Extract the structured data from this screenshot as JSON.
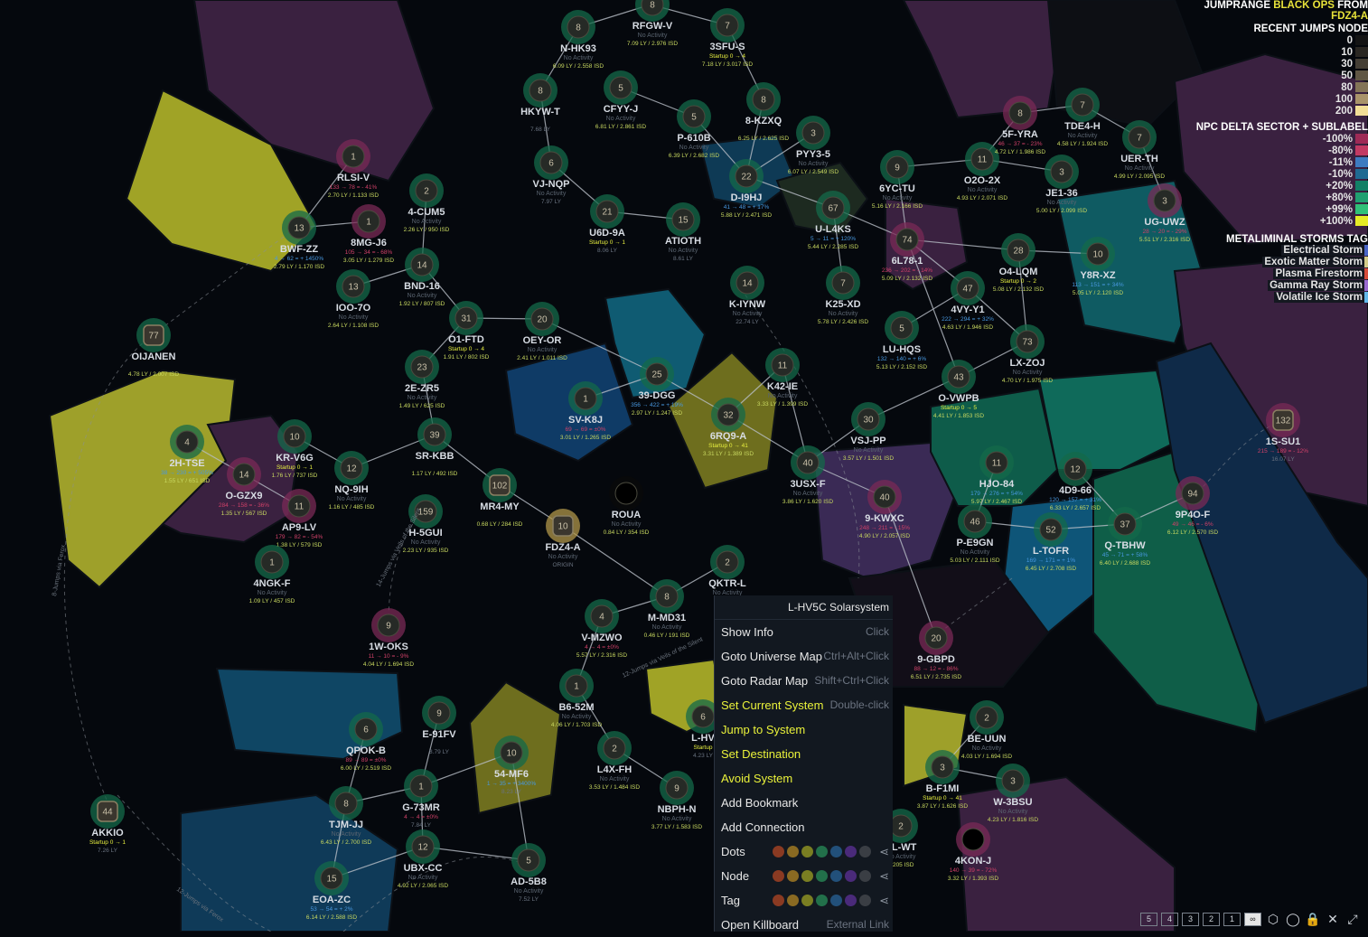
{
  "header": {
    "jumprange_prefix": "JUMPRANGE",
    "ship": "BLACK OPS",
    "from_label": "FROM",
    "origin": "FDZ4-A"
  },
  "legends": {
    "recent_jumps": {
      "title": "RECENT JUMPS NODE",
      "items": [
        {
          "label": "0",
          "color": "#141414"
        },
        {
          "label": "10",
          "color": "#2a2722"
        },
        {
          "label": "30",
          "color": "#443e34"
        },
        {
          "label": "50",
          "color": "#605744"
        },
        {
          "label": "80",
          "color": "#837457"
        },
        {
          "label": "100",
          "color": "#a9936a"
        },
        {
          "label": "200",
          "color": "#f2de96"
        }
      ]
    },
    "npc_delta": {
      "title": "NPC DELTA SECTOR + SUBLABEL",
      "items": [
        {
          "label": "-100%",
          "color": "#9e2a56"
        },
        {
          "label": "-80%",
          "color": "#c23a63"
        },
        {
          "label": "-11%",
          "color": "#3d7bc0"
        },
        {
          "label": "-10%",
          "color": "#1f6a92"
        },
        {
          "label": "+20%",
          "color": "#128066"
        },
        {
          "label": "+80%",
          "color": "#20a070"
        },
        {
          "label": "+99%",
          "color": "#30c078"
        },
        {
          "label": "+100%",
          "color": "#e6ec26"
        }
      ]
    },
    "storms": {
      "title": "METALIMINAL STORMS TAG",
      "items": [
        {
          "label": "Electrical Storm",
          "color": "#4a66c6"
        },
        {
          "label": "Exotic Matter Storm",
          "color": "#d4cc88"
        },
        {
          "label": "Plasma Firestorm",
          "color": "#d84c3a"
        },
        {
          "label": "Gamma Ray Storm",
          "color": "#9a6ad0"
        },
        {
          "label": "Volatile Ice Storm",
          "color": "#62b8ea"
        }
      ]
    }
  },
  "context_menu": {
    "title": "L-HV5C Solarsystem",
    "items": [
      {
        "label": "Show Info",
        "hint": "Click",
        "highlight": false
      },
      {
        "label": "Goto Universe Map",
        "hint": "Ctrl+Alt+Click",
        "highlight": false
      },
      {
        "label": "Goto Radar Map",
        "hint": "Shift+Ctrl+Click",
        "highlight": false
      },
      {
        "label": "Set Current System",
        "hint": "Double-click",
        "highlight": true
      },
      {
        "label": "Jump to System",
        "hint": "",
        "highlight": true
      },
      {
        "label": "Set Destination",
        "hint": "",
        "highlight": true
      },
      {
        "label": "Avoid System",
        "hint": "",
        "highlight": true
      },
      {
        "label": "Add Bookmark",
        "hint": "",
        "highlight": false
      },
      {
        "label": "Add Connection",
        "hint": "",
        "highlight": false
      }
    ],
    "color_rows": [
      {
        "label": "Dots"
      },
      {
        "label": "Node"
      },
      {
        "label": "Tag"
      }
    ],
    "palette": [
      "#8a3a22",
      "#8a6a22",
      "#7a7e22",
      "#22704a",
      "#22507a",
      "#4a2a7a",
      "#3a3e44"
    ],
    "last_item": {
      "label": "Open Killboard",
      "hint": "External Link"
    }
  },
  "zoom_buttons": [
    "5",
    "4",
    "3",
    "2",
    "1",
    "∞"
  ],
  "systems": [
    {
      "name": "RFGW-V",
      "count": "8",
      "sub": "No Activity",
      "info": "7.09 LY / 2.976 ISD"
    },
    {
      "name": "N-HK93",
      "count": "8",
      "sub": "No Activity",
      "info": "6.09 LY / 2.558 ISD"
    },
    {
      "name": "3SFU-S",
      "count": "7",
      "sub": "Startup 0 → 4",
      "info": "7.18 LY / 3.017 ISD"
    },
    {
      "name": "HKYW-T",
      "count": "8",
      "sub": "",
      "info": "7.68 LY"
    },
    {
      "name": "CFYY-J",
      "count": "5",
      "sub": "No Activity",
      "info": "6.81 LY / 2.861 ISD"
    },
    {
      "name": "P-610B",
      "count": "5",
      "sub": "No Activity",
      "info": "6.39 LY / 2.682 ISD"
    },
    {
      "name": "8-KZXQ",
      "count": "8",
      "sub": "",
      "info": "6.25 LY / 2.625 ISD"
    },
    {
      "name": "PYY3-5",
      "count": "3",
      "sub": "No Activity",
      "info": "6.07 LY / 2.549 ISD"
    },
    {
      "name": "D-I9HJ",
      "count": "22",
      "sub": "41 → 48 = + 17%",
      "info": "5.88 LY / 2.471 ISD"
    },
    {
      "name": "VJ-NQP",
      "count": "6",
      "sub": "No Activity",
      "info": "7.97 LY"
    },
    {
      "name": "U6D-9A",
      "count": "21",
      "sub": "Startup 0 → 1",
      "info": "8.06 LY"
    },
    {
      "name": "ATIOTH",
      "count": "15",
      "sub": "No Activity",
      "info": "8.61 LY"
    },
    {
      "name": "U-L4KS",
      "count": "67",
      "sub": "5 → 11 = + 120%",
      "info": "5.44 LY / 2.285 ISD"
    },
    {
      "name": "6YC-TU",
      "count": "9",
      "sub": "No Activity",
      "info": "5.16 LY / 2.166 ISD"
    },
    {
      "name": "O2O-2X",
      "count": "11",
      "sub": "No Activity",
      "info": "4.93 LY / 2.071 ISD"
    },
    {
      "name": "5F-YRA",
      "count": "8",
      "sub": "46 → 37 = - 23%",
      "info": "4.72 LY / 1.986 ISD"
    },
    {
      "name": "TDE4-H",
      "count": "7",
      "sub": "No Activity",
      "info": "4.58 LY / 1.924 ISD"
    },
    {
      "name": "UER-TH",
      "count": "7",
      "sub": "No Activity",
      "info": "4.99 LY / 2.095 ISD"
    },
    {
      "name": "JE1-36",
      "count": "3",
      "sub": "No Activity",
      "info": "5.00 LY / 2.099 ISD"
    },
    {
      "name": "UG-UWZ",
      "count": "3",
      "sub": "28 → 20 = - 29%",
      "info": "5.51 LY / 2.316 ISD"
    },
    {
      "name": "RLSI-V",
      "count": "1",
      "sub": "133 → 78 = - 41%",
      "info": "2.70 LY / 1.133 ISD"
    },
    {
      "name": "4-CUM5",
      "count": "2",
      "sub": "No Activity",
      "info": "2.26 LY / 950 ISD"
    },
    {
      "name": "BWF-ZZ",
      "count": "13",
      "sub": "4 → 62 = + 1450%",
      "info": "2.79 LY / 1.170 ISD"
    },
    {
      "name": "8MG-J6",
      "count": "1",
      "sub": "105 → 34 = - 68%",
      "info": "3.05 LY / 1.279 ISD"
    },
    {
      "name": "BND-16",
      "count": "14",
      "sub": "No Activity",
      "info": "1.92 LY / 807 ISD"
    },
    {
      "name": "IOO-7O",
      "count": "13",
      "sub": "No Activity",
      "info": "2.64 LY / 1.108 ISD"
    },
    {
      "name": "O1-FTD",
      "count": "31",
      "sub": "Startup 0 → 4",
      "info": "1.91 LY / 802 ISD"
    },
    {
      "name": "OEY-OR",
      "count": "20",
      "sub": "No Activity",
      "info": "2.41 LY / 1.011 ISD"
    },
    {
      "name": "OIJANEN",
      "count": "77",
      "sub": "",
      "info": "4.78 LY / 2.007 ISD"
    },
    {
      "name": "2E-ZR5",
      "count": "23",
      "sub": "No Activity",
      "info": "1.49 LY / 625 ISD"
    },
    {
      "name": "K-IYNW",
      "count": "14",
      "sub": "No Activity",
      "info": "22.74 LY"
    },
    {
      "name": "K25-XD",
      "count": "7",
      "sub": "No Activity",
      "info": "5.78 LY / 2.426 ISD"
    },
    {
      "name": "6L78-1",
      "count": "74",
      "sub": "236 → 202 = - 14%",
      "info": "5.09 LY / 2.132 ISD"
    },
    {
      "name": "O4-LQM",
      "count": "28",
      "sub": "Startup 0 → 2",
      "info": "5.08 LY / 2.132 ISD"
    },
    {
      "name": "Y8R-XZ",
      "count": "10",
      "sub": "113 → 151 = + 34%",
      "info": "5.05 LY / 2.120 ISD"
    },
    {
      "name": "4VY-Y1",
      "count": "47",
      "sub": "222 → 294 = + 32%",
      "info": "4.63 LY / 1.946 ISD"
    },
    {
      "name": "LU-HQS",
      "count": "5",
      "sub": "132 → 140 = + 6%",
      "info": "5.13 LY / 2.152 ISD"
    },
    {
      "name": "LX-ZOJ",
      "count": "73",
      "sub": "No Activity",
      "info": "4.70 LY / 1.975 ISD"
    },
    {
      "name": "O-VWPB",
      "count": "43",
      "sub": "Startup 0 → 5",
      "info": "4.41 LY / 1.853 ISD"
    },
    {
      "name": "SV-K8J",
      "count": "1",
      "sub": "69 → 69 = ±0%",
      "info": "3.01 LY / 1.265 ISD"
    },
    {
      "name": "39-DGG",
      "count": "25",
      "sub": "356 → 422 = + 19%",
      "info": "2.97 LY / 1.247 ISD"
    },
    {
      "name": "K42-IE",
      "count": "11",
      "sub": "No Activity",
      "info": "3.33 LY / 1.399 ISD"
    },
    {
      "name": "6RQ9-A",
      "count": "32",
      "sub": "Startup 0 → 41",
      "info": "3.31 LY / 1.389 ISD"
    },
    {
      "name": "VSJ-PP",
      "count": "30",
      "sub": "No Activity",
      "info": "3.57 LY / 1.501 ISD"
    },
    {
      "name": "3USX-F",
      "count": "40",
      "sub": "No Activity",
      "info": "3.86 LY / 1.620 ISD"
    },
    {
      "name": "1S-SU1",
      "count": "132",
      "sub": "215 → 189 = - 12%",
      "info": "16.07 LY"
    },
    {
      "name": "2H-TSE",
      "count": "4",
      "sub": "38 → 230 = + 505%",
      "info": "1.55 LY / 651 ISD"
    },
    {
      "name": "KR-V6G",
      "count": "10",
      "sub": "Startup 0 → 1",
      "info": "1.76 LY / 737 ISD"
    },
    {
      "name": "O-GZX9",
      "count": "14",
      "sub": "284 → 158 = - 36%",
      "info": "1.35 LY / 567 ISD"
    },
    {
      "name": "NQ-9IH",
      "count": "12",
      "sub": "No Activity",
      "info": "1.16 LY / 485 ISD"
    },
    {
      "name": "AP9-LV",
      "count": "11",
      "sub": "179 → 82 = - 54%",
      "info": "1.38 LY / 579 ISD"
    },
    {
      "name": "SR-KBB",
      "count": "39",
      "sub": "",
      "info": "1.17 LY / 492 ISD"
    },
    {
      "name": "MR4-MY",
      "count": "102",
      "sub": "",
      "info": "0.68 LY / 284 ISD"
    },
    {
      "name": "H-5GUI",
      "count": "159",
      "sub": "No Activity",
      "info": "2.23 LY / 935 ISD"
    },
    {
      "name": "ROUA",
      "count": "",
      "sub": "No Activity",
      "info": "0.84 LY / 354 ISD"
    },
    {
      "name": "FDZ4-A",
      "count": "10",
      "sub": "No Activity",
      "info": "ORIGIN"
    },
    {
      "name": "4NGK-F",
      "count": "1",
      "sub": "No Activity",
      "info": "1.09 LY / 457 ISD"
    },
    {
      "name": "HJO-84",
      "count": "11",
      "sub": "179 → 276 = + 54%",
      "info": "5.97 LY / 2.467 ISD"
    },
    {
      "name": "4D9-66",
      "count": "12",
      "sub": "120 → 157 = + 31%",
      "info": "6.33 LY / 2.657 ISD"
    },
    {
      "name": "9P4O-F",
      "count": "94",
      "sub": "49 → 46 = - 6%",
      "info": "6.12 LY / 2.570 ISD"
    },
    {
      "name": "9-KWXC",
      "count": "40",
      "sub": "248 → 211 = - 15%",
      "info": "4.90 LY / 2.057 ISD"
    },
    {
      "name": "P-E9GN",
      "count": "46",
      "sub": "No Activity",
      "info": "5.03 LY / 2.111 ISD"
    },
    {
      "name": "L-TOFR",
      "count": "52",
      "sub": "169 → 171 = + 1%",
      "info": "6.45 LY / 2.708 ISD"
    },
    {
      "name": "Q-TBHW",
      "count": "37",
      "sub": "45 → 71 = + 58%",
      "info": "6.40 LY / 2.688 ISD"
    },
    {
      "name": "QKTR-L",
      "count": "2",
      "sub": "No Activity",
      "info": "1.9"
    },
    {
      "name": "1W-OKS",
      "count": "9",
      "sub": "11 → 10 = - 9%",
      "info": "4.04 LY / 1.694 ISD"
    },
    {
      "name": "V-MZWO",
      "count": "4",
      "sub": "4 → 4 = ±0%",
      "info": "5.57 LY / 2.316 ISD"
    },
    {
      "name": "M-MD31",
      "count": "8",
      "sub": "No Activity",
      "info": "0.46 LY / 191 ISD"
    },
    {
      "name": "9-GBPD",
      "count": "20",
      "sub": "88 → 12 = - 86%",
      "info": "6.51 LY / 2.735 ISD"
    },
    {
      "name": "B6-52M",
      "count": "1",
      "sub": "No Activity",
      "info": "4.06 LY / 1.703 ISD"
    },
    {
      "name": "QPOK-B",
      "count": "6",
      "sub": "89 → 89 = ±0%",
      "info": "6.00 LY / 2.519 ISD"
    },
    {
      "name": "E-91FV",
      "count": "9",
      "sub": "",
      "info": "8.79 LY"
    },
    {
      "name": "54-MF6",
      "count": "10",
      "sub": "1 → 35 = + 3400%",
      "info": "8.23 LY"
    },
    {
      "name": "L4X-FH",
      "count": "2",
      "sub": "No Activity",
      "info": "3.53 LY / 1.484 ISD"
    },
    {
      "name": "L-HV",
      "count": "6",
      "sub": "Startup",
      "info": "4.23 LY"
    },
    {
      "name": "NBPH-N",
      "count": "9",
      "sub": "No Activity",
      "info": "3.77 LY / 1.583 ISD"
    },
    {
      "name": "BE-UUN",
      "count": "2",
      "sub": "No Activity",
      "info": "4.03 LY / 1.694 ISD"
    },
    {
      "name": "B-F1MI",
      "count": "3",
      "sub": "Startup 0 → 41",
      "info": "3.87 LY / 1.626 ISD"
    },
    {
      "name": "W-3BSU",
      "count": "3",
      "sub": "No Activity",
      "info": "4.23 LY / 1.816 ISD"
    },
    {
      "name": "AKKIO",
      "count": "44",
      "sub": "Startup 0 → 1",
      "info": "7.26 LY"
    },
    {
      "name": "TJM-JJ",
      "count": "8",
      "sub": "No Activity",
      "info": "6.43 LY / 2.700 ISD"
    },
    {
      "name": "G-73MR",
      "count": "1",
      "sub": "4 → 4 = ±0%",
      "info": "7.84 LY"
    },
    {
      "name": "UBX-CC",
      "count": "12",
      "sub": "No Activity",
      "info": "4.92 LY / 2.065 ISD"
    },
    {
      "name": "AD-5B8",
      "count": "5",
      "sub": "No Activity",
      "info": "7.52 LY"
    },
    {
      "name": "EOA-ZC",
      "count": "15",
      "sub": "53 → 54 = + 2%",
      "info": "6.14 LY / 2.588 ISD"
    },
    {
      "name": "4KON-J",
      "count": "",
      "sub": "140 → 39 = - 72%",
      "info": "3.32 LY / 1.393 ISD"
    },
    {
      "name": "XL-WT",
      "count": "2",
      "sub": "No Activity",
      "info": "1.205 ISD"
    }
  ],
  "route_labels": [
    "8-Jumps via Ferox",
    "14-Jumps via Veils of the Silent",
    "12-Jumps via Veils of the Silent",
    "12-Jumps via Ferox"
  ]
}
